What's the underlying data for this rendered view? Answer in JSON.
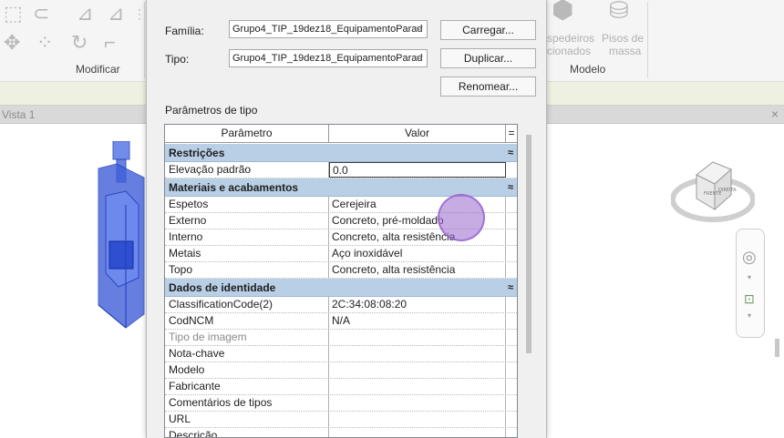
{
  "ribbon": {
    "panels": [
      {
        "label": "Modificar"
      },
      {
        "label": "Modelo"
      }
    ],
    "ghost_texts": [
      "spedeiros",
      "Pisos de",
      "cionados",
      "massa"
    ]
  },
  "view": {
    "tab_label": "Vista 1",
    "close_glyph": "×"
  },
  "dialog": {
    "familia_label": "Família:",
    "familia_value": "Grupo4_TIP_19dez18_EquipamentoParad",
    "tipo_label": "Tipo:",
    "tipo_value": "Grupo4_TIP_19dez18_EquipamentoParad",
    "carregar": "Carregar...",
    "duplicar": "Duplicar...",
    "renomear": "Renomear...",
    "params_title": "Parâmetros de tipo",
    "col_param": "Parâmetro",
    "col_valor": "Valor",
    "col_eq": "="
  },
  "groups": [
    {
      "name": "Restrições",
      "collapse": "≈",
      "rows": [
        {
          "param": "Elevação padrão",
          "value": "0.0",
          "editing": true
        }
      ]
    },
    {
      "name": "Materiais e acabamentos",
      "collapse": "≈",
      "rows": [
        {
          "param": "Espetos",
          "value": "Cerejeira"
        },
        {
          "param": "Externo",
          "value": "Concreto, pré-moldado"
        },
        {
          "param": "Interno",
          "value": "Concreto, alta resistência"
        },
        {
          "param": "Metais",
          "value": "Aço inoxidável"
        },
        {
          "param": "Topo",
          "value": "Concreto, alta resistência"
        }
      ]
    },
    {
      "name": "Dados de identidade",
      "collapse": "≈",
      "rows": [
        {
          "param": "ClassificationCode(2)",
          "value": "2C:34:08:08:20"
        },
        {
          "param": "CodNCM",
          "value": "N/A"
        },
        {
          "param": "Tipo de imagem",
          "value": "",
          "gray": true
        },
        {
          "param": "Nota-chave",
          "value": ""
        },
        {
          "param": "Modelo",
          "value": ""
        },
        {
          "param": "Fabricante",
          "value": ""
        },
        {
          "param": "Comentários de tipos",
          "value": ""
        },
        {
          "param": "URL",
          "value": ""
        },
        {
          "param": "Descrição",
          "value": ""
        }
      ]
    }
  ],
  "colors": {
    "group_header": "#b9cfe6",
    "cursor": "#9966cc",
    "model_blue": "#3355dd"
  }
}
